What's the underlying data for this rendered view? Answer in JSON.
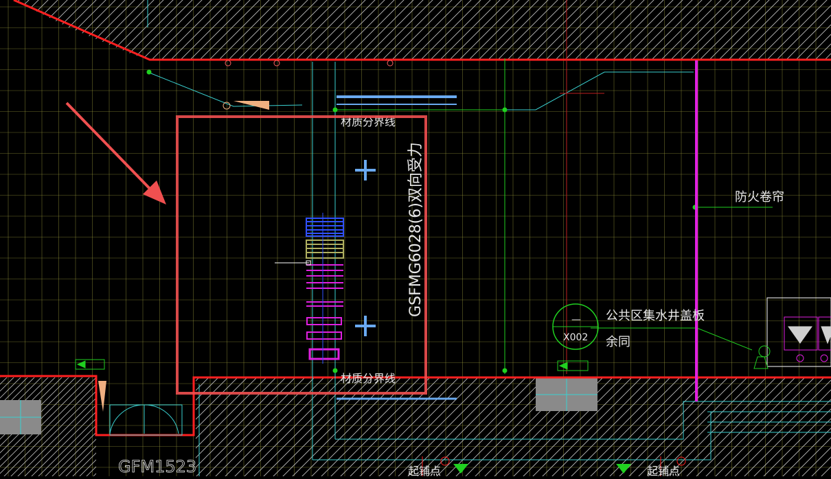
{
  "canvas": {
    "background": "#000000",
    "colors": {
      "wall_outline": "#ff2020",
      "highlight_box": "#f05050",
      "grid": "#9a9a3c",
      "hatch": "#bdbdbd",
      "cyan": "#3ad0d0",
      "magenta": "#e020e0",
      "green": "#20d020",
      "blue_lines": "#6aaaf0",
      "text": "#e8e8e8"
    }
  },
  "labels": {
    "boundary_top": "材质分界线",
    "boundary_bottom": "材质分界线",
    "door_label": "GSFMG6028(6)双向受力",
    "fire_shutter": "防火卷帘",
    "sump_cover": "公共区集水井盖板",
    "same_as": "余同",
    "tag_top": "—",
    "tag_id": "X002",
    "door_code": "GFM1523",
    "anchor_1": "起铺点",
    "anchor_2": "起铺点"
  },
  "annotation": {
    "arrow_icon": "red-arrow-icon",
    "box": "highlight-rectangle"
  }
}
